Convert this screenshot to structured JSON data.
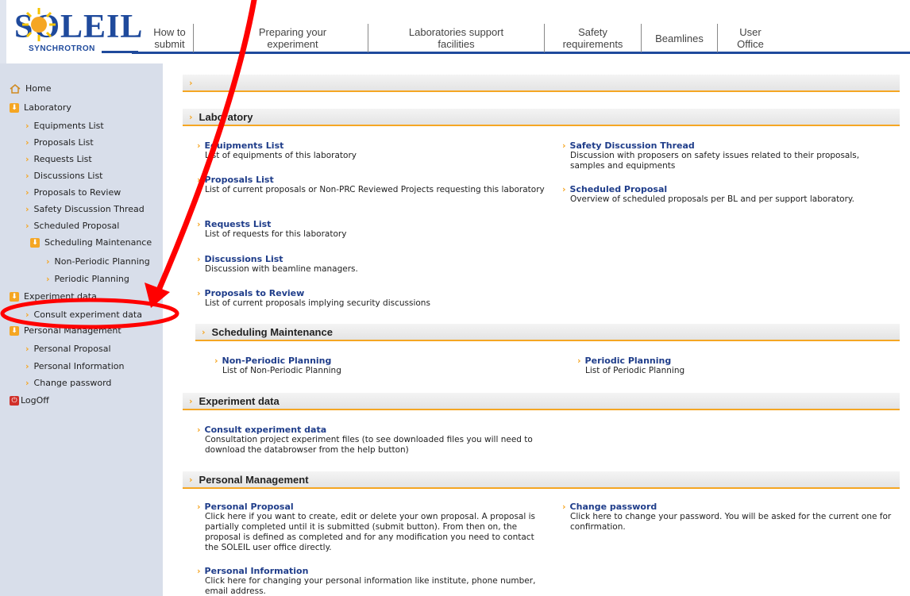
{
  "logo": {
    "word": "SOLEIL",
    "sub": "SYNCHROTRON"
  },
  "nav": [
    {
      "label": "How to\nsubmit"
    },
    {
      "label": "Preparing your\nexperiment"
    },
    {
      "label": "Laboratories support\nfacilities"
    },
    {
      "label": "Safety\nrequirements"
    },
    {
      "label": "Beamlines"
    },
    {
      "label": "User\nOffice"
    }
  ],
  "sidebar": {
    "home": "Home",
    "laboratory": "Laboratory",
    "lab_items": [
      "Equipments List",
      "Proposals List",
      "Requests List",
      "Discussions List",
      "Proposals to Review",
      "Safety Discussion Thread",
      "Scheduled Proposal"
    ],
    "scheduling": "Scheduling Maintenance",
    "sched_items": [
      "Non-Periodic Planning",
      "Periodic Planning"
    ],
    "experiment": "Experiment data",
    "exp_items": [
      "Consult experiment data"
    ],
    "personal": "Personal Management",
    "personal_items": [
      "Personal Proposal",
      "Personal Information",
      "Change password"
    ],
    "logoff": "LogOff"
  },
  "content": {
    "empty_bar": "",
    "laboratory": {
      "title": "Laboratory",
      "left": [
        {
          "title": "Equipments List",
          "desc": "List of equipments of this laboratory"
        },
        {
          "title": "Proposals List",
          "desc": "List of current proposals or Non-PRC Reviewed Projects requesting this laboratory"
        },
        {
          "title": "Requests List",
          "desc": "List of requests for this laboratory"
        },
        {
          "title": "Discussions List",
          "desc": "Discussion with beamline managers."
        },
        {
          "title": "Proposals to Review",
          "desc": "List of current proposals implying security discussions"
        }
      ],
      "right": [
        {
          "title": "Safety Discussion Thread",
          "desc": "Discussion with proposers on safety issues related to their proposals, samples and equipments"
        },
        {
          "title": "Scheduled Proposal",
          "desc": "Overview of scheduled proposals per BL and per support laboratory."
        }
      ]
    },
    "scheduling": {
      "title": "Scheduling Maintenance",
      "left": {
        "title": "Non-Periodic Planning",
        "desc": "List of Non-Periodic Planning"
      },
      "right": {
        "title": "Periodic Planning",
        "desc": "List of Periodic Planning"
      }
    },
    "experiment": {
      "title": "Experiment data",
      "entry": {
        "title": "Consult experiment data",
        "desc": "Consultation project experiment files (to see downloaded files you will need to download the databrowser from the help button)"
      }
    },
    "personal": {
      "title": "Personal Management",
      "left": [
        {
          "title": "Personal Proposal",
          "desc": "Click here if you want to create, edit or delete your own proposal. A proposal is partially completed until it is submitted (submit button). From then on, the proposal is defined as completed and for any modification you need to contact the SOLEIL user office directly."
        },
        {
          "title": "Personal Information",
          "desc": "Click here for changing your personal information like institute, phone number, email address."
        }
      ],
      "right": {
        "title": "Change password",
        "desc": "Click here to change your password. You will be asked for the current one for confirmation."
      }
    }
  },
  "colors": {
    "accent": "#f5a623",
    "link": "#1f3d8a",
    "brand": "#1f4a9c",
    "annotation": "#ff0000"
  }
}
